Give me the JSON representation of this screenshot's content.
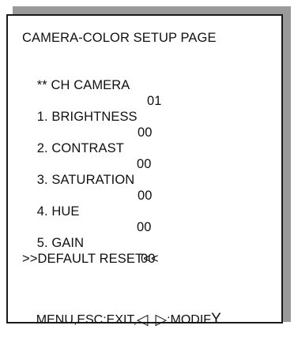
{
  "screen": {
    "title": "CAMERA-COLOR SETUP PAGE",
    "channel": {
      "label": "** CH CAMERA",
      "value": "01"
    },
    "items": [
      {
        "label": "1. BRIGHTNESS",
        "value": "00"
      },
      {
        "label": "2. CONTRAST",
        "value": "00"
      },
      {
        "label": "3. SATURATION",
        "value": "00"
      },
      {
        "label": "4. HUE",
        "value": "00"
      },
      {
        "label": "5. GAIN",
        "value": "00"
      }
    ],
    "reset": ">>DEFAULT RESET<<",
    "footer": {
      "prefix": "MENU,ESC:EXIT,",
      "left_arrow": "◁",
      "right_arrow": "▷",
      "suffix": ":MODIF",
      "suffix_end": "Y"
    }
  }
}
